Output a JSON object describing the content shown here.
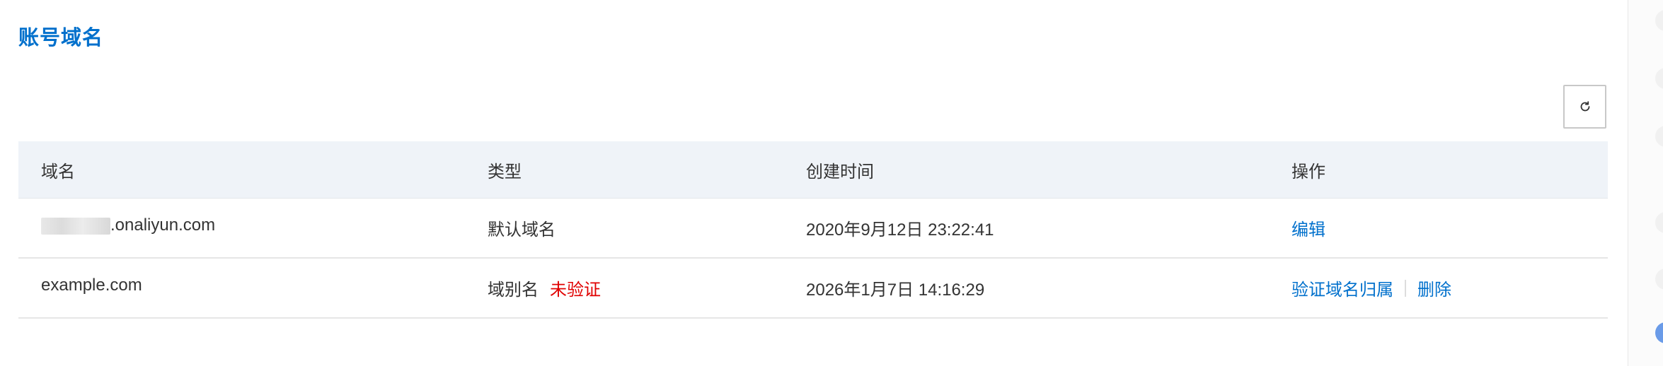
{
  "section": {
    "title": "账号域名"
  },
  "toolbar": {
    "refresh_icon": "refresh-icon"
  },
  "table": {
    "headers": {
      "domain": "域名",
      "type": "类型",
      "created": "创建时间",
      "ops": "操作"
    },
    "rows": [
      {
        "domain": ".onaliyun.com",
        "type": "默认域名",
        "status": "",
        "created": "2020年9月12日 23:22:41",
        "ops": [
          "编辑"
        ]
      },
      {
        "domain": "example.com",
        "type": "域别名",
        "status": "未验证",
        "created": "2026年1月7日 14:16:29",
        "ops": [
          "验证域名归属",
          "删除"
        ]
      }
    ]
  },
  "colors": {
    "accent": "#0070cc",
    "header_bg": "#eff3f8",
    "warning": "#e00000"
  }
}
